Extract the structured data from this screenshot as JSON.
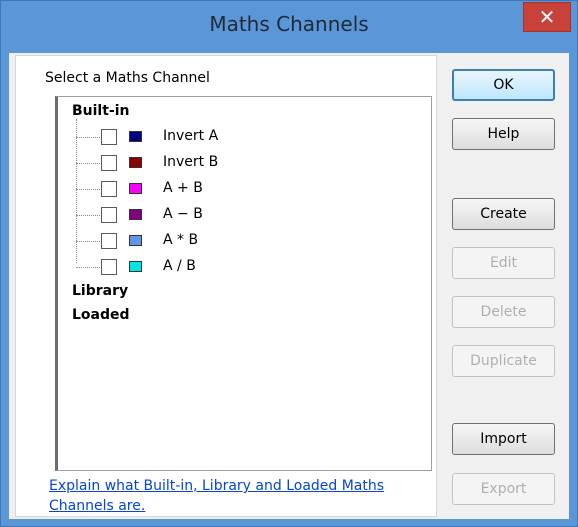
{
  "window": {
    "title": "Maths Channels",
    "close_glyph": "✕"
  },
  "group": {
    "label": "Select a Maths Channel"
  },
  "tree": {
    "builtin_label": "Built-in",
    "library_label": "Library",
    "loaded_label": "Loaded",
    "items": [
      {
        "label": "Invert A",
        "color": "#000080",
        "checked": false
      },
      {
        "label": "Invert B",
        "color": "#8b0000",
        "checked": false
      },
      {
        "label": "A + B",
        "color": "#ff00ff",
        "checked": false
      },
      {
        "label": "A − B",
        "color": "#800080",
        "checked": false
      },
      {
        "label": "A * B",
        "color": "#6495ed",
        "checked": false
      },
      {
        "label": "A / B",
        "color": "#00e5e5",
        "checked": false
      }
    ]
  },
  "help_link": "Explain what Built-in, Library and Loaded Maths Channels are.",
  "buttons": {
    "ok": "OK",
    "help": "Help",
    "create": "Create",
    "edit": "Edit",
    "delete": "Delete",
    "duplicate": "Duplicate",
    "import": "Import",
    "export": "Export"
  }
}
